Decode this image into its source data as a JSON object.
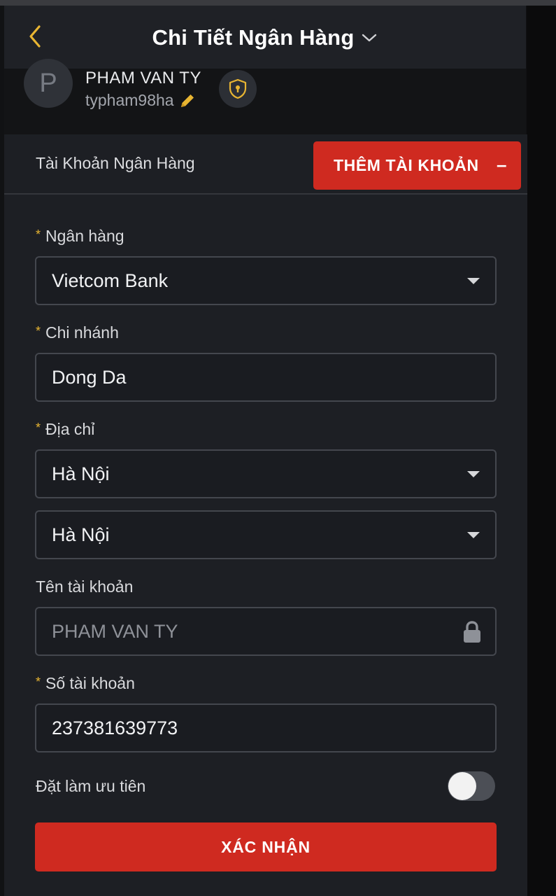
{
  "colors": {
    "accent_red": "#cf2a20",
    "accent_yellow": "#e8b532",
    "background": "#1d1f24"
  },
  "header": {
    "title": "Chi Tiết Ngân Hàng",
    "back_icon": "chevron-left-icon",
    "dropdown_icon": "chevron-down-icon"
  },
  "profile": {
    "avatar_initial": "P",
    "name": "PHAM VAN TY",
    "username": "typham98ha",
    "edit_icon": "pencil-icon",
    "security_icon": "shield-icon"
  },
  "bank_section": {
    "title": "Tài Khoản Ngân Hàng",
    "add_button": "THÊM TÀI KHOẢN",
    "collapse_symbol": "–"
  },
  "form": {
    "required_mark": "*",
    "bank": {
      "label": "Ngân hàng",
      "value": "Vietcom Bank"
    },
    "branch": {
      "label": "Chi nhánh",
      "value": "Dong Da"
    },
    "address": {
      "label": "Địa chỉ",
      "province": "Hà Nội",
      "city": "Hà Nội"
    },
    "account_name": {
      "label": "Tên tài khoản",
      "value": "PHAM VAN TY"
    },
    "account_number": {
      "label": "Số tài khoản",
      "value": "237381639773"
    },
    "priority": {
      "label": "Đặt làm ưu tiên",
      "enabled": false
    },
    "submit_label": "XÁC NHẬN"
  }
}
